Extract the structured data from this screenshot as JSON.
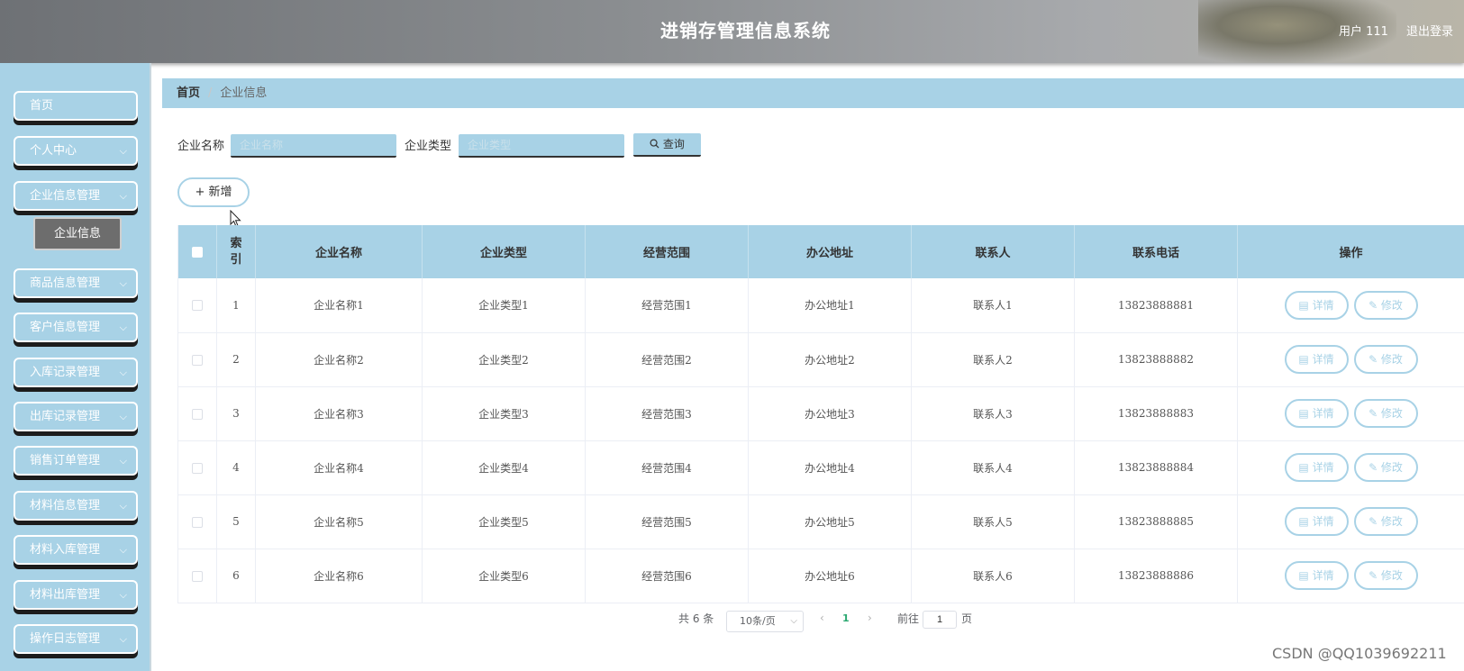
{
  "header": {
    "title": "进销存管理信息系统",
    "user": "用户 111",
    "logout": "退出登录"
  },
  "sidebar": {
    "items": [
      {
        "label": "首页",
        "chevron": ""
      },
      {
        "label": "个人中心",
        "chevron": "⌵"
      },
      {
        "label": "企业信息管理",
        "chevron": "⌵"
      },
      {
        "label": "商品信息管理",
        "chevron": "⌵"
      },
      {
        "label": "客户信息管理",
        "chevron": "⌵"
      },
      {
        "label": "入库记录管理",
        "chevron": "⌵"
      },
      {
        "label": "出库记录管理",
        "chevron": "⌵"
      },
      {
        "label": "销售订单管理",
        "chevron": "⌵"
      },
      {
        "label": "材料信息管理",
        "chevron": "⌵"
      },
      {
        "label": "材料入库管理",
        "chevron": "⌵"
      },
      {
        "label": "材料出库管理",
        "chevron": "⌵"
      },
      {
        "label": "操作日志管理",
        "chevron": "⌵"
      }
    ],
    "subitem": "企业信息"
  },
  "breadcrumb": {
    "home": "首页",
    "separator": "/",
    "current": "企业信息"
  },
  "search": {
    "name_label": "企业名称",
    "name_placeholder": "企业名称",
    "type_label": "企业类型",
    "type_placeholder": "企业类型",
    "query_label": "查询",
    "query_icon": "search-icon"
  },
  "actions": {
    "add_label": "+ 新增"
  },
  "table": {
    "columns": [
      "索引",
      "企业名称",
      "企业类型",
      "经营范围",
      "办公地址",
      "联系人",
      "联系电话",
      "操作"
    ],
    "rows": [
      {
        "index": "1",
        "name": "企业名称1",
        "type": "企业类型1",
        "scope": "经营范围1",
        "address": "办公地址1",
        "contact": "联系人1",
        "phone": "13823888881"
      },
      {
        "index": "2",
        "name": "企业名称2",
        "type": "企业类型2",
        "scope": "经营范围2",
        "address": "办公地址2",
        "contact": "联系人2",
        "phone": "13823888882"
      },
      {
        "index": "3",
        "name": "企业名称3",
        "type": "企业类型3",
        "scope": "经营范围3",
        "address": "办公地址3",
        "contact": "联系人3",
        "phone": "13823888883"
      },
      {
        "index": "4",
        "name": "企业名称4",
        "type": "企业类型4",
        "scope": "经营范围4",
        "address": "办公地址4",
        "contact": "联系人4",
        "phone": "13823888884"
      },
      {
        "index": "5",
        "name": "企业名称5",
        "type": "企业类型5",
        "scope": "经营范围5",
        "address": "办公地址5",
        "contact": "联系人5",
        "phone": "13823888885"
      },
      {
        "index": "6",
        "name": "企业名称6",
        "type": "企业类型6",
        "scope": "经营范围6",
        "address": "办公地址6",
        "contact": "联系人6",
        "phone": "13823888886"
      }
    ],
    "detail_label": "▤ 详情",
    "edit_label": "✎ 修改"
  },
  "pagination": {
    "total": "共 6 条",
    "page_size": "10条/页",
    "prev": "‹",
    "current_page": "1",
    "next": "›",
    "goto_label": "前往",
    "goto_value": "1",
    "page_unit": "页"
  },
  "watermark": "CSDN @QQ1039692211",
  "colors": {
    "accent": "#a8d2e6",
    "active_page": "#2aa870",
    "submenu_bg": "#6d6d6d"
  }
}
